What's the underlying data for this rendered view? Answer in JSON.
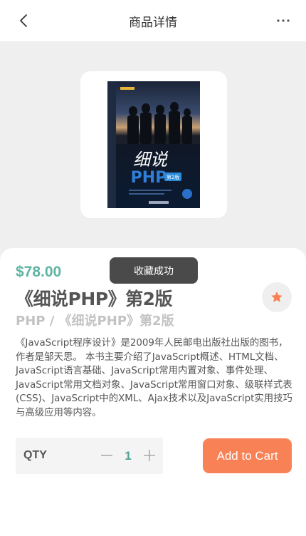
{
  "nav": {
    "title": "商品详情",
    "back_icon": "chevron-left-icon",
    "more_icon": "more-dots-icon"
  },
  "product": {
    "price": "$78.00",
    "title": "《细说PHP》第2版",
    "subtitle": "PHP / 《细说PHP》第2版",
    "description": "《JavaScript程序设计》是2009年人民邮电出版社出版的图书，作者是邹天思。 本书主要介绍了JavaScript概述、HTML文档、JavaScript语言基础、JavaScript常用内置对象、事件处理、JavaScript常用文档对象、JavaScript常用窗口对象、级联样式表(CSS)、JavaScript中的XML、Ajax技术以及JavaScript实用技巧与高级应用等内容。",
    "cover": {
      "title_chars": "细说",
      "title_latin": "PHP",
      "badge": "第2版"
    }
  },
  "toast": {
    "text": "收藏成功"
  },
  "quantity": {
    "label": "QTY",
    "value": "1"
  },
  "actions": {
    "add_to_cart": "Add to Cart"
  },
  "colors": {
    "price": "#5fb4a3",
    "accent": "#f88155",
    "favorite_star": "#f88155",
    "qty_value": "#4fa295"
  }
}
